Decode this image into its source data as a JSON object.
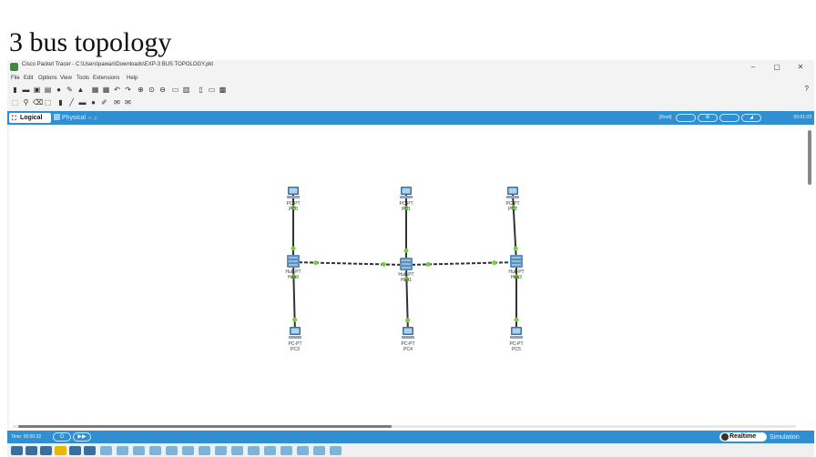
{
  "document_title": "3 bus topology",
  "window": {
    "title": "Cisco Packet Tracer - C:\\Users\\pawan\\Downloads\\EXP-3 BUS TOPOLOGY.pkt",
    "controls": [
      "–",
      "▢",
      "✕"
    ]
  },
  "menu": [
    "File",
    "Edit",
    "Options",
    "View",
    "Tools",
    "Extensions",
    "Help"
  ],
  "toolbar_help": "?",
  "tabs": {
    "logical": "Logical",
    "physical": "Physical",
    "physical_coords": "x: ,y:"
  },
  "topbar": {
    "root": "[Root]",
    "clock": "00:01:03"
  },
  "nodes": [
    {
      "id": "pc0",
      "type": "pc",
      "model": "PC-PT",
      "name": "PC0"
    },
    {
      "id": "pc1",
      "type": "pc",
      "model": "PC-PT",
      "name": "PC1"
    },
    {
      "id": "pc2",
      "type": "pc",
      "model": "PC-PT",
      "name": "PC2"
    },
    {
      "id": "hub0",
      "type": "hub",
      "model": "Hub-PT",
      "name": "Hub0"
    },
    {
      "id": "hub1",
      "type": "hub",
      "model": "Hub-PT",
      "name": "Hub1"
    },
    {
      "id": "hub2",
      "type": "hub",
      "model": "Hub-PT",
      "name": "Hub2"
    },
    {
      "id": "pc3",
      "type": "pc",
      "model": "PC-PT",
      "name": "PC3"
    },
    {
      "id": "pc4",
      "type": "pc",
      "model": "PC-PT",
      "name": "PC4"
    },
    {
      "id": "pc5",
      "type": "pc",
      "model": "PC-PT",
      "name": "PC5"
    }
  ],
  "links": [
    {
      "from": "pc0",
      "to": "hub0",
      "style": "solid"
    },
    {
      "from": "pc1",
      "to": "hub1",
      "style": "solid"
    },
    {
      "from": "pc2",
      "to": "hub2",
      "style": "solid"
    },
    {
      "from": "hub0",
      "to": "pc3",
      "style": "solid"
    },
    {
      "from": "hub1",
      "to": "pc4",
      "style": "solid"
    },
    {
      "from": "hub2",
      "to": "pc5",
      "style": "solid"
    },
    {
      "from": "hub0",
      "to": "hub1",
      "style": "dashed"
    },
    {
      "from": "hub1",
      "to": "hub2",
      "style": "dashed"
    }
  ],
  "colors": {
    "accent": "#2f8fd0",
    "link_light": "#6fcf3f",
    "canvas": "#ffffff"
  },
  "statusbar": {
    "time": "Time: 00:00:32",
    "realtime": "Realtime",
    "simulation": "Simulation"
  }
}
